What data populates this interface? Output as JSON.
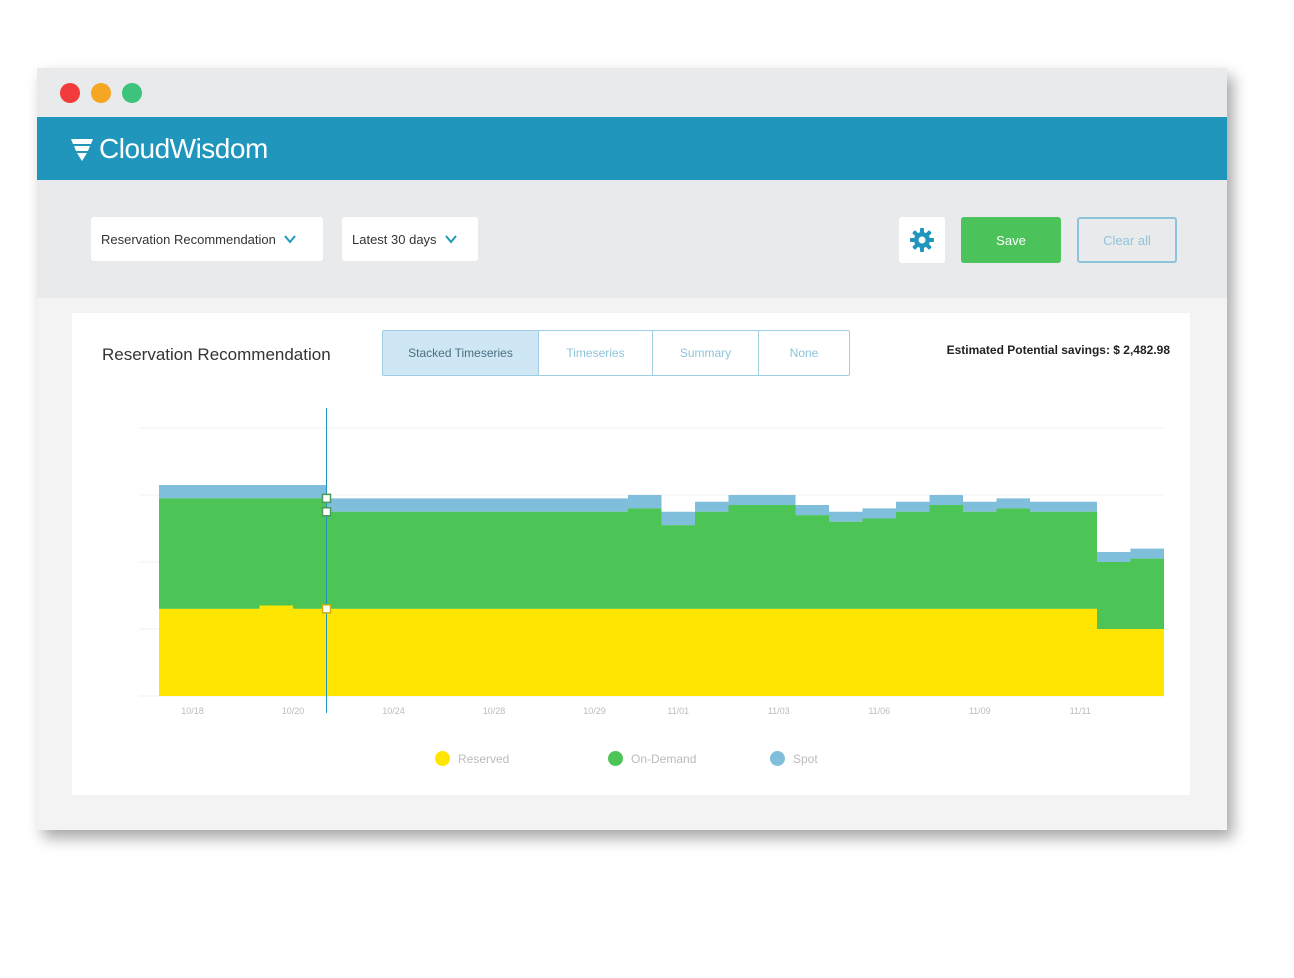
{
  "app": {
    "brand": "CloudWisdom",
    "window_controls": [
      "close",
      "minimize",
      "maximize"
    ]
  },
  "toolbar": {
    "report_select": "Reservation Recommendation",
    "range_select": "Latest 30 days",
    "settings_icon": "gear-icon",
    "save_label": "Save",
    "clear_label": "Clear all"
  },
  "panel": {
    "title": "Reservation Recommendation",
    "tabs": [
      {
        "label": "Stacked Timeseries",
        "active": true
      },
      {
        "label": "Timeseries",
        "active": false
      },
      {
        "label": "Summary",
        "active": false
      },
      {
        "label": "None",
        "active": false
      }
    ],
    "savings": "Estimated Potential savings: $ 2,482.98"
  },
  "colors": {
    "reserved": "#ffe500",
    "on_demand": "#4cc456",
    "spot": "#7fbfdc",
    "header": "#2196bd",
    "save": "#4cc25a"
  },
  "chart_data": {
    "type": "area",
    "stacked": true,
    "x": [
      0,
      1,
      2,
      3,
      4,
      5,
      6,
      7,
      8,
      9,
      10,
      11,
      12,
      13,
      14,
      15,
      16,
      17,
      18,
      19,
      20,
      21,
      22,
      23,
      24,
      25,
      26,
      27,
      28,
      29
    ],
    "xticks": [
      {
        "x": 1,
        "label": "10/18"
      },
      {
        "x": 4,
        "label": "10/20"
      },
      {
        "x": 7,
        "label": "10/24"
      },
      {
        "x": 10,
        "label": "10/28"
      },
      {
        "x": 13,
        "label": "10/29"
      },
      {
        "x": 15.5,
        "label": "11/01"
      },
      {
        "x": 18.5,
        "label": "11/03"
      },
      {
        "x": 21.5,
        "label": "11/06"
      },
      {
        "x": 24.5,
        "label": "11/09"
      },
      {
        "x": 27.5,
        "label": "11/11"
      }
    ],
    "ylim": [
      0,
      40
    ],
    "series": [
      {
        "name": "Reserved",
        "values": [
          13,
          13,
          13,
          13.5,
          13,
          13,
          13,
          13,
          13,
          13,
          13,
          13,
          13,
          13,
          13,
          13,
          13,
          13,
          13,
          13,
          13,
          13,
          13,
          13,
          13,
          13,
          13,
          13,
          10,
          10
        ]
      },
      {
        "name": "On-Demand",
        "values": [
          16.5,
          16.5,
          16.5,
          16,
          16.5,
          14.5,
          14.5,
          14.5,
          14.5,
          14.5,
          14.5,
          14.5,
          14.5,
          14.5,
          15,
          12.5,
          14.5,
          15.5,
          15.5,
          14,
          13,
          13.5,
          14.5,
          15.5,
          14.5,
          15,
          14.5,
          14.5,
          10,
          10.5
        ]
      },
      {
        "name": "Spot",
        "values": [
          2,
          2,
          2,
          2,
          2,
          2,
          2,
          2,
          2,
          2,
          2,
          2,
          2,
          2,
          2,
          2,
          1.5,
          1.5,
          1.5,
          1.5,
          1.5,
          1.5,
          1.5,
          1.5,
          1.5,
          1.5,
          1.5,
          1.5,
          1.5,
          1.5
        ]
      }
    ],
    "cursor_x": 5,
    "legend_position": "bottom"
  }
}
